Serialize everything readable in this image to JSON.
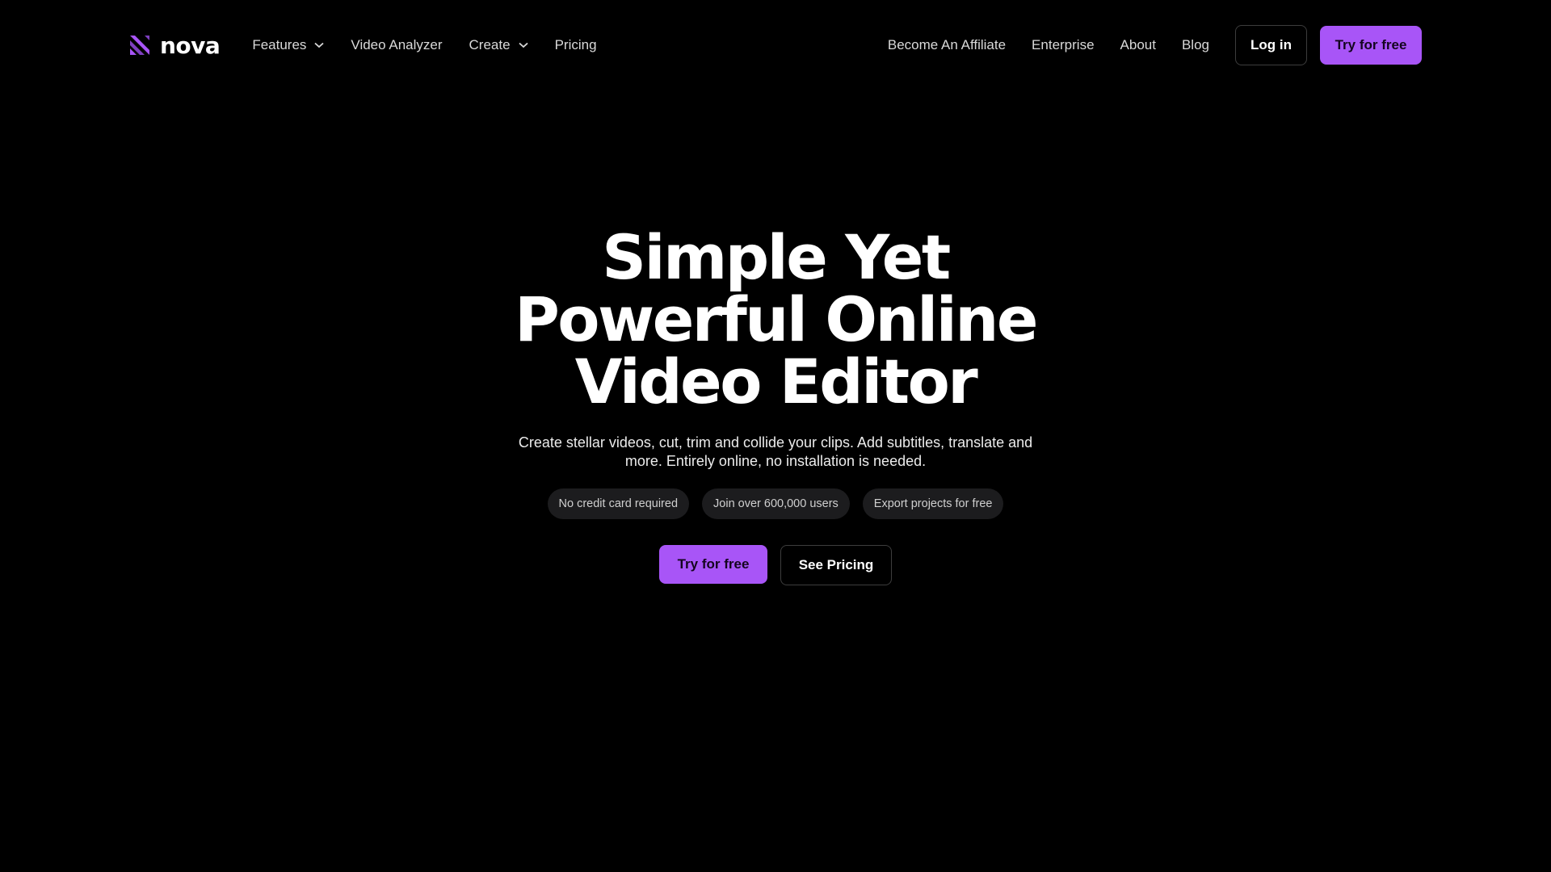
{
  "brand": {
    "name": "nova",
    "accent": "#a855f7",
    "icon": "nova-logo-icon"
  },
  "nav": {
    "left": [
      {
        "label": "Features",
        "dropdown": true
      },
      {
        "label": "Video Analyzer",
        "dropdown": false
      },
      {
        "label": "Create",
        "dropdown": true
      },
      {
        "label": "Pricing",
        "dropdown": false
      }
    ],
    "right": [
      "Become An Affiliate",
      "Enterprise",
      "About",
      "Blog"
    ],
    "login_label": "Log in",
    "try_label": "Try for free"
  },
  "hero": {
    "title_lines": [
      "Simple Yet",
      "Powerful Online",
      "Video Editor"
    ],
    "subtitle": "Create stellar videos, cut, trim and collide your clips. Add subtitles, translate and more. Entirely online, no installation is needed.",
    "badges": [
      "No credit card required",
      "Join over 600,000 users",
      "Export projects for free"
    ],
    "cta_primary": "Try for free",
    "cta_secondary": "See Pricing"
  }
}
